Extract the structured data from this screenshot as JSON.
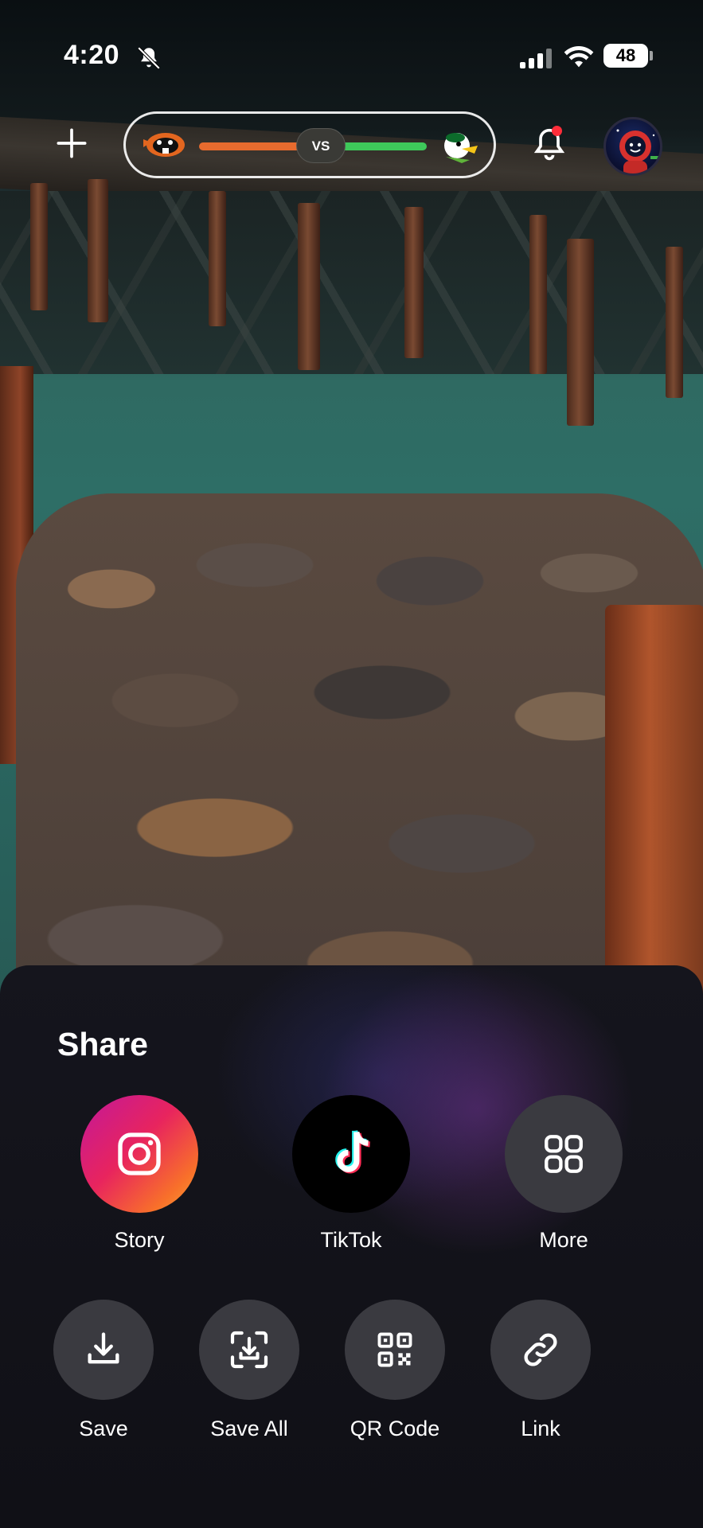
{
  "status_bar": {
    "time": "4:20",
    "battery": "48",
    "icons": [
      "bell-slash-icon",
      "cellular-signal-icon",
      "wifi-icon",
      "battery-icon"
    ]
  },
  "top_bar": {
    "icons": [
      "plus-icon",
      "team-beaver-logo",
      "team-duck-logo",
      "bell-icon",
      "astronaut-avatar"
    ],
    "matchup": {
      "vs_label": "VS",
      "left_color": "#e76b2e",
      "right_color": "#3ec95a"
    },
    "has_notification": true
  },
  "share_sheet": {
    "title": "Share",
    "primary_actions": [
      {
        "label": "Story",
        "icon": "instagram-icon"
      },
      {
        "label": "TikTok",
        "icon": "tiktok-icon"
      },
      {
        "label": "More",
        "icon": "grid-icon"
      }
    ],
    "secondary_actions": [
      {
        "label": "Save",
        "icon": "download-icon"
      },
      {
        "label": "Save All",
        "icon": "download-all-icon"
      },
      {
        "label": "QR Code",
        "icon": "qr-code-icon"
      },
      {
        "label": "Link",
        "icon": "link-icon"
      }
    ]
  }
}
